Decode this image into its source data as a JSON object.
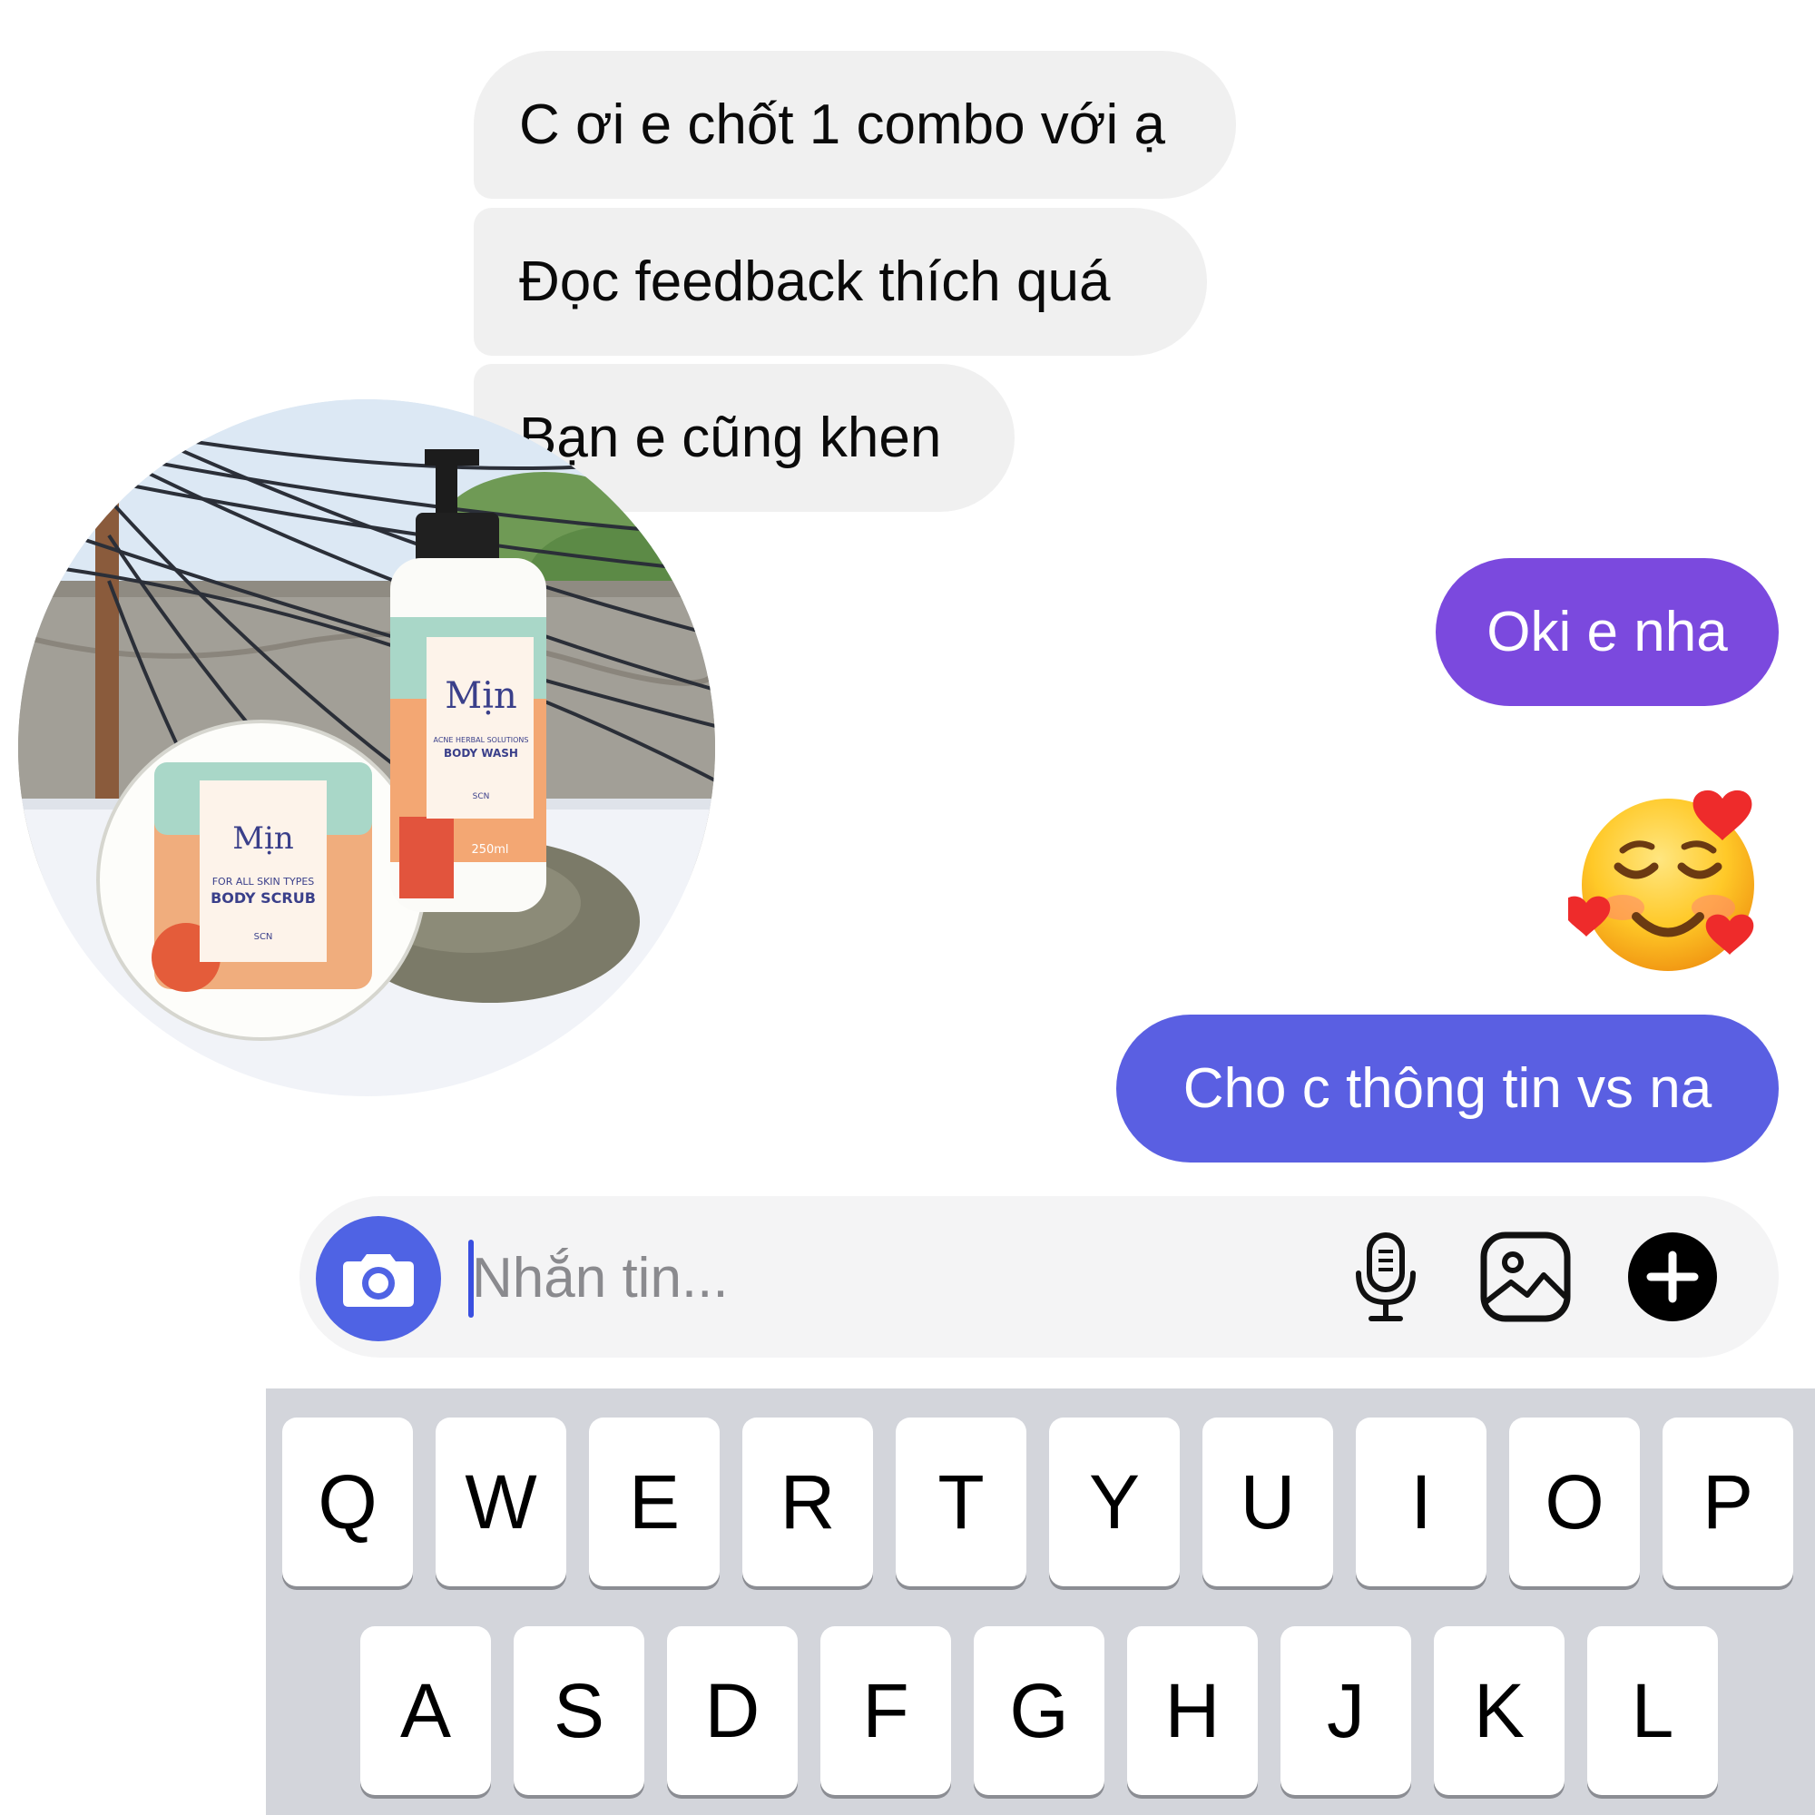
{
  "messages": {
    "incoming": [
      "C ơi e chốt 1 combo với ạ",
      "Đọc feedback thích quá",
      "Bạn e cũng khen"
    ],
    "outgoing": [
      "Oki e nha",
      "Cho c thông tin vs na"
    ],
    "reaction": "smiling-face-with-hearts"
  },
  "product_photo": {
    "jar": {
      "brand": "Mịn",
      "line1": "FOR ALL SKIN TYPES",
      "line2": "BODY SCRUB",
      "maker": "SCN"
    },
    "bottle": {
      "brand": "Mịn",
      "line1": "ACNE HERBAL SOLUTIONS",
      "line2": "BODY WASH",
      "maker": "SCN",
      "volume": "250ml"
    }
  },
  "composer": {
    "placeholder": "Nhắn tin...",
    "icons": [
      "camera-icon",
      "microphone-icon",
      "image-icon",
      "plus-icon"
    ],
    "accent": "#4f63e4"
  },
  "keyboard": {
    "row1": [
      "Q",
      "W",
      "E",
      "R",
      "T",
      "Y",
      "U",
      "I",
      "O",
      "P"
    ],
    "row2": [
      "A",
      "S",
      "D",
      "F",
      "G",
      "H",
      "J",
      "K",
      "L"
    ]
  },
  "colors": {
    "incoming_bubble": "#f0f0f0",
    "outgoing_bubble_1": "#7b49de",
    "outgoing_bubble_2": "#5a5fe2",
    "keyboard_bg": "#d3d5db"
  }
}
